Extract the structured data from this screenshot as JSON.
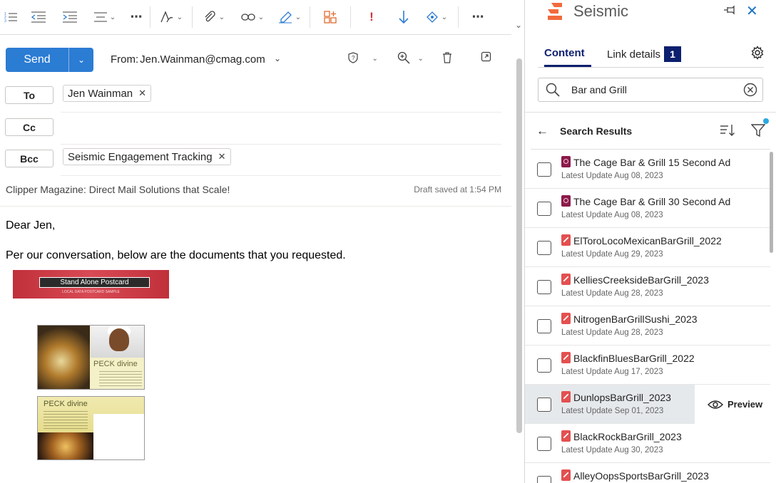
{
  "compose": {
    "send_label": "Send",
    "from_label": "From:",
    "from_value": "Jen.Wainman@cmag.com",
    "to_label": "To",
    "cc_label": "Cc",
    "bcc_label": "Bcc",
    "to_recipients": [
      "Jen Wainman"
    ],
    "bcc_recipients": [
      "Seismic Engagement Tracking"
    ],
    "subject": "Clipper Magazine: Direct Mail Solutions that Scale!",
    "draft_status": "Draft saved at 1:54 PM",
    "body_greeting": "Dear Jen,",
    "body_intro": "Per our conversation, below are the documents that you requested."
  },
  "attachments": {
    "postcard_title": "Stand Alone Postcard",
    "postcard_subtitle": "LOCAL DATA POSTCARD SAMPLE",
    "card_brand": "PECK divine"
  },
  "panel": {
    "app_name": "Seismic",
    "tabs": [
      {
        "label": "Content",
        "active": true
      },
      {
        "label": "Link details",
        "badge": "1"
      }
    ],
    "search_value": "Bar and Grill",
    "results_title": "Search Results",
    "preview_label": "Preview",
    "results": [
      {
        "name": "The Cage Bar & Grill 15 Second Ad",
        "date": "Latest Update Aug 08, 2023",
        "type": "video"
      },
      {
        "name": "The Cage Bar & Grill 30 Second Ad",
        "date": "Latest Update Aug 08, 2023",
        "type": "video"
      },
      {
        "name": "ElToroLocoMexicanBarGrill_2022",
        "date": "Latest Update Aug 29, 2023",
        "type": "pdf"
      },
      {
        "name": "KelliesCreeksideBarGrill_2023",
        "date": "Latest Update Aug 28, 2023",
        "type": "pdf"
      },
      {
        "name": "NitrogenBarGrillSushi_2023",
        "date": "Latest Update Aug 28, 2023",
        "type": "pdf"
      },
      {
        "name": "BlackfinBluesBarGrill_2022",
        "date": "Latest Update Aug 17, 2023",
        "type": "pdf"
      },
      {
        "name": "DunlopsBarGrill_2023",
        "date": "Latest Update Sep 01, 2023",
        "type": "pdf",
        "hover": true
      },
      {
        "name": "BlackRockBarGrill_2023",
        "date": "Latest Update Aug 30, 2023",
        "type": "pdf"
      },
      {
        "name": "AlleyOopsSportsBarGrill_2023",
        "date": "",
        "type": "pdf"
      }
    ]
  },
  "colors": {
    "send_blue": "#2b7cd3",
    "seismic_navy": "#0c1f6e",
    "seismic_orange": "#f26a3d",
    "pdf_red": "#e45050",
    "video_maroon": "#8b1a4a"
  }
}
